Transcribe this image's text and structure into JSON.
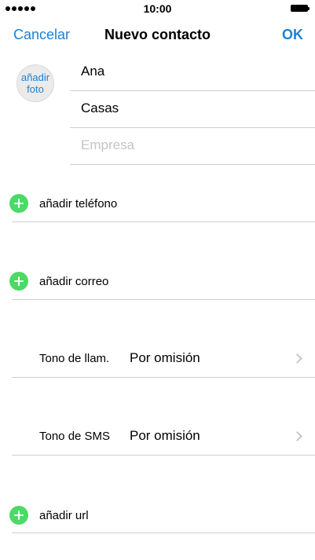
{
  "status_bar": {
    "time": "10:00",
    "signal_icon": "signal-dots-icon",
    "battery_icon": "battery-icon"
  },
  "nav": {
    "cancel": "Cancelar",
    "title": "Nuevo contacto",
    "done": "OK"
  },
  "photo": {
    "label": "añadir\nfoto"
  },
  "fields": {
    "first_name": "Ana",
    "last_name": "Casas",
    "company_placeholder": "Empresa"
  },
  "rows": {
    "add_phone": "añadir teléfono",
    "add_email": "añadir correo",
    "ringtone_label": "Tono de llam.",
    "ringtone_value": "Por omisión",
    "text_tone_label": "Tono de SMS",
    "text_tone_value": "Por omisión",
    "add_url": "añadir url"
  },
  "colors": {
    "accent": "#1a82d6",
    "add_green": "#4cd964",
    "separator": "#cfcfcf",
    "placeholder": "#c4c4c4"
  }
}
